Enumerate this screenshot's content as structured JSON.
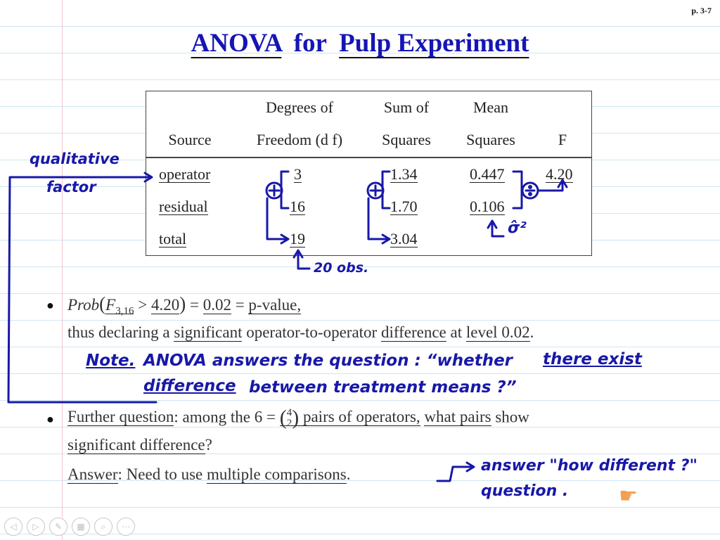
{
  "page_label": "p. 3-7",
  "title": {
    "part1": "ANOVA",
    "part2": "for",
    "part3": "Pulp Experiment"
  },
  "table": {
    "header1": {
      "dof": "Degrees of",
      "ss": "Sum of",
      "ms": "Mean"
    },
    "header2": {
      "source": "Source",
      "dof": "Freedom (d f)",
      "ss": "Squares",
      "ms": "Squares",
      "f": "F"
    },
    "rows": [
      {
        "source": "operator",
        "dof": "3",
        "ss": "1.34",
        "ms": "0.447",
        "f": "4.20"
      },
      {
        "source": "residual",
        "dof": "16",
        "ss": "1.70",
        "ms": "0.106",
        "f": ""
      },
      {
        "source": "total",
        "dof": "19",
        "ss": "3.04",
        "ms": "",
        "f": ""
      }
    ]
  },
  "bullet1": {
    "prob": "Prob",
    "F": "F",
    "sub": "3,16",
    "gt": "> 4.20",
    "eq1": "= 0.02 =",
    "pval": "p-value,",
    "line2_a": "thus declaring a",
    "significant": "significant",
    "line2_b": "operator-to-operator",
    "difference": "difference",
    "line2_c": "at",
    "level": "level 0.02",
    "period": "."
  },
  "bullet2": {
    "further": "Further question",
    "colon": ": among the 6 =",
    "binom_top": "4",
    "binom_bottom": "2",
    "pairs_a": "pairs of operators,",
    "what_pairs": "what pairs",
    "show": "show",
    "sig_diff": "significant difference",
    "qmark": "?",
    "answer": "Answer",
    "need": ": Need to use",
    "mc": "multiple comparisons",
    "period2": "."
  },
  "annotations": {
    "qualitative": "qualitative",
    "factor": "factor",
    "obs": "20 obs.",
    "sigma": "σ̂²",
    "note_label": "Note.",
    "note_text1": "ANOVA answers the question : “whether",
    "note_there": "there exist",
    "note_diff": "difference",
    "note_text2": "between treatment means ?”",
    "answer_how": "answer \"how different ?\"",
    "question": "question ."
  },
  "colors": {
    "title": "#1515b5",
    "ink": "#1818a8",
    "rule": "#cfe6f2",
    "margin": "#f2c7cf"
  },
  "nav_icons": [
    "prev-icon",
    "next-icon",
    "pen-icon",
    "pages-icon",
    "zoom-icon",
    "more-icon"
  ]
}
